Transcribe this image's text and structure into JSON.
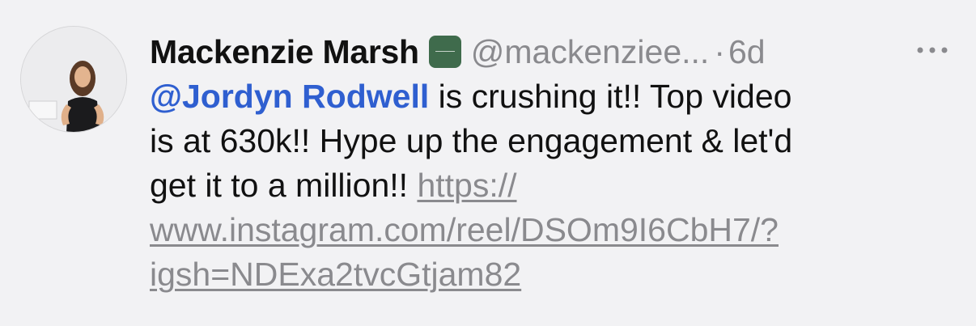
{
  "post": {
    "display_name": "Mackenzie Marsh",
    "handle": "@mackenziee...",
    "separator": "·",
    "time": "6d",
    "mention": "@Jordyn Rodwell",
    "text_line1_rest": " is crushing it!! Top video",
    "text_line2": "is at 630k!! Hype up the engagement & let'd",
    "text_line3_start": "get it to a million!! ",
    "link_part1": "https://",
    "link_part2": "www.instagram.com/reel/DSOm9I6CbH7/?",
    "link_part3": "igsh=NDExa2tvcGtjam82"
  },
  "icons": {
    "avatar": "avatar-photo",
    "badge": "verified-badge-icon",
    "more": "more-options-icon"
  },
  "colors": {
    "background": "#f2f2f4",
    "mention": "#2f5fd0",
    "secondary_text": "#8a8a8e",
    "badge": "#3f6b4c"
  }
}
